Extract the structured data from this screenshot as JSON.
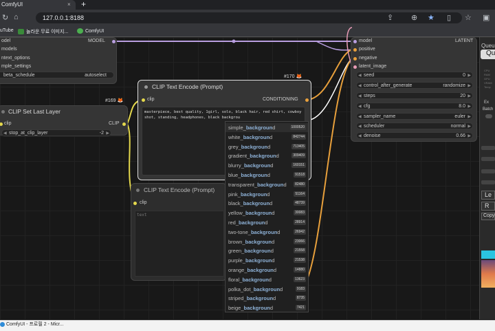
{
  "browser": {
    "tab_title": "ComfyUI",
    "tab_close": "×",
    "new_tab": "+",
    "url": "127.0.0.1:8188",
    "bookmarks": [
      "uTube",
      "놀라운 무료 이미지...",
      "ComfyUI"
    ]
  },
  "nodes": {
    "left_top": {
      "model_out": "MODEL",
      "row_model": "odel",
      "row_models": "models",
      "row_context": "ntext_options",
      "row_sample": "mple_settings",
      "beta_label": "beta_schedule",
      "beta_value": "autoselect"
    },
    "clip_set_last_layer": {
      "badge": "#169",
      "title": "CLIP Set Last Layer",
      "in_label": "clip",
      "out_label": "CLIP",
      "widget_label": "stop_at_clip_layer",
      "widget_value": "-2"
    },
    "clip_text_encode_1": {
      "badge": "#170",
      "title": "CLIP Text Encode (Prompt)",
      "in_label": "clip",
      "out_label": "CONDITIONING",
      "text": "masterpiece, best quality, 1girl, solo, black hair, red shirt, cowboy shot, standing, headphones, black backgrou"
    },
    "clip_text_encode_2": {
      "title": "CLIP Text Encode (Prompt)",
      "in_label": "clip",
      "placeholder": "text"
    },
    "ksampler": {
      "out_label": "LATENT",
      "inputs": [
        "model",
        "positive",
        "negative",
        "latent_image"
      ],
      "widgets": [
        {
          "label": "seed",
          "value": "0"
        },
        {
          "label": "control_after_generate",
          "value": "randomize"
        },
        {
          "label": "steps",
          "value": "20"
        },
        {
          "label": "cfg",
          "value": "8.0"
        },
        {
          "label": "sampler_name",
          "value": "euler"
        },
        {
          "label": "scheduler",
          "value": "normal"
        },
        {
          "label": "denoise",
          "value": "0.66"
        }
      ]
    }
  },
  "autocomplete": {
    "typed": "backgrou",
    "items": [
      {
        "pre": "simple_",
        "match": "backgroun",
        "post": "d",
        "count": "1000520"
      },
      {
        "pre": "white_",
        "match": "backgroun",
        "post": "d",
        "count": "842744"
      },
      {
        "pre": "grey_",
        "match": "backgroun",
        "post": "d",
        "count": "713405"
      },
      {
        "pre": "gradient_",
        "match": "backgroun",
        "post": "d",
        "count": "309409"
      },
      {
        "pre": "blurry_",
        "match": "backgroun",
        "post": "d",
        "count": "160151"
      },
      {
        "pre": "blue_",
        "match": "backgroun",
        "post": "d",
        "count": "91518"
      },
      {
        "pre": "transparent_",
        "match": "backgroun",
        "post": "d",
        "count": "82480"
      },
      {
        "pre": "pink_",
        "match": "backgroun",
        "post": "d",
        "count": "51164"
      },
      {
        "pre": "black_",
        "match": "backgroun",
        "post": "d",
        "count": "48739"
      },
      {
        "pre": "yellow_",
        "match": "backgroun",
        "post": "d",
        "count": "30083"
      },
      {
        "pre": "red_",
        "match": "backgroun",
        "post": "d",
        "count": "28914"
      },
      {
        "pre": "two-tone_",
        "match": "backgroun",
        "post": "d",
        "count": "26942"
      },
      {
        "pre": "brown_",
        "match": "backgroun",
        "post": "d",
        "count": "23066"
      },
      {
        "pre": "green_",
        "match": "backgroun",
        "post": "d",
        "count": "21558"
      },
      {
        "pre": "purple_",
        "match": "backgroun",
        "post": "d",
        "count": "21538"
      },
      {
        "pre": "orange_",
        "match": "backgroun",
        "post": "d",
        "count": "14880"
      },
      {
        "pre": "floral_",
        "match": "backgroun",
        "post": "d",
        "count": "13623"
      },
      {
        "pre": "polka_dot_",
        "match": "backgroun",
        "post": "d",
        "count": "9183"
      },
      {
        "pre": "striped_",
        "match": "backgroun",
        "post": "d",
        "count": "8735"
      },
      {
        "pre": "beige_",
        "match": "backgroun",
        "post": "d",
        "count": "7421"
      }
    ]
  },
  "right_panel": {
    "queue_label": "Queu",
    "queue_btn": "Qu",
    "batch_label": "Batch",
    "btn_ex": "Ex",
    "btn_l": "Le",
    "btn_r": "R",
    "btn_copy": "Copy"
  },
  "taskbar": {
    "item": "ComfyUI - 프로필 2 - Micr..."
  },
  "colors": {
    "accent_orange": "#e8a03c",
    "link_purple": "#b99ee0",
    "link_yellow": "#e4d84c",
    "autocomplete_match": "#8fb3d9"
  }
}
